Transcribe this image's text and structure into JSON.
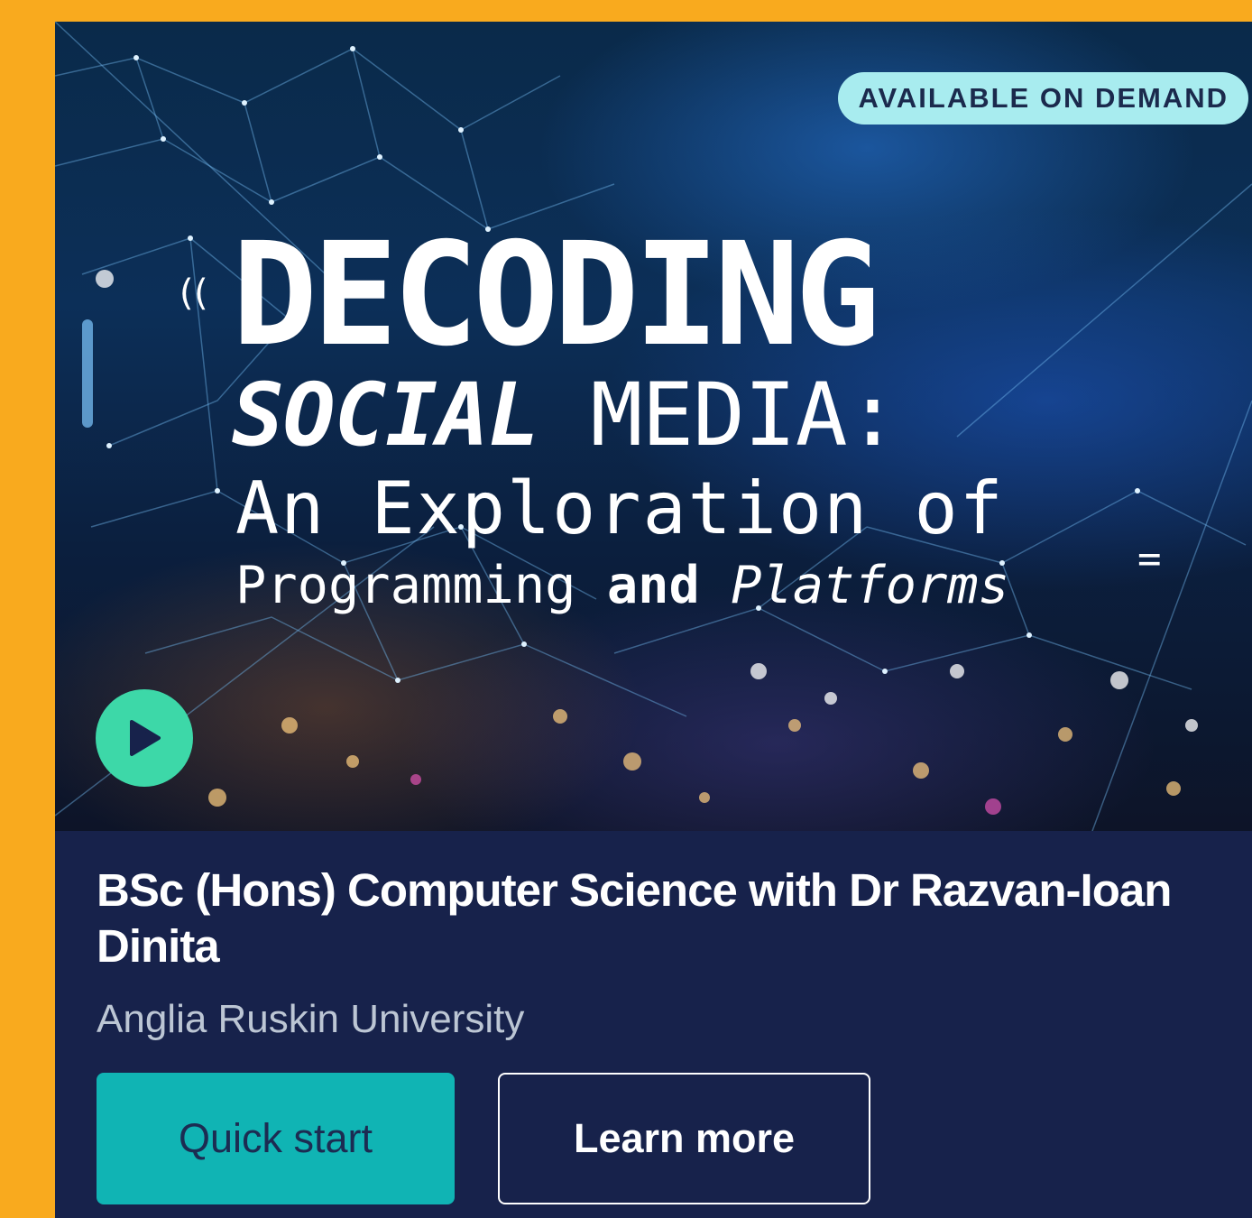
{
  "badge": {
    "label": "AVAILABLE ON DEMAND"
  },
  "hero": {
    "line1": "DECODING",
    "line2_italic": "SOCIAL",
    "line2_rest": " MEDIA:",
    "line3": "An Exploration of",
    "line4_a": "Programming ",
    "line4_b": "and",
    "line4_c": " Platforms",
    "signal_glyph": "((",
    "equals_glyph": "="
  },
  "play_icon": "play-icon",
  "course": {
    "title": "BSc (Hons) Computer Science with Dr Razvan-Ioan Dinita",
    "provider": "Anglia Ruskin University"
  },
  "buttons": {
    "primary": "Quick start",
    "secondary": "Learn more"
  },
  "colors": {
    "background": "#f9aa1e",
    "card": "#17224b",
    "badge": "#a8ecef",
    "play": "#3dd8a8",
    "primary_button": "#10b4b4"
  }
}
